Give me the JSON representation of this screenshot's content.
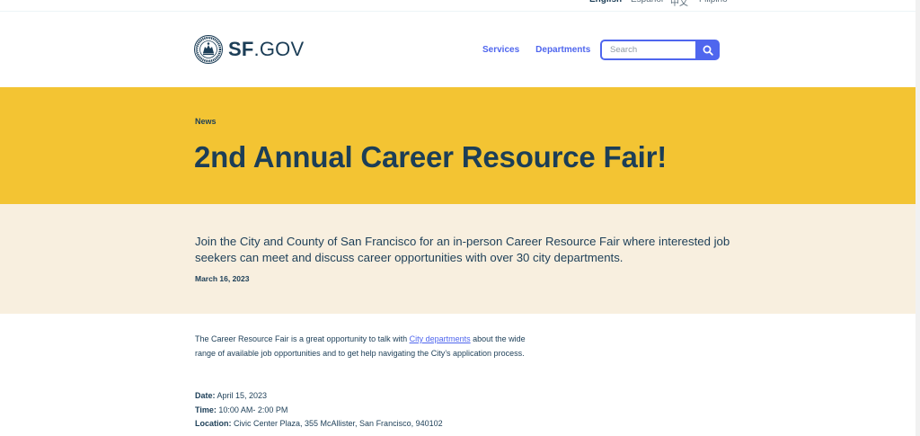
{
  "language_bar": {
    "languages": [
      "English",
      "Español",
      "中文",
      "Filipino"
    ]
  },
  "header": {
    "logo_bold": "SF",
    "logo_rest": ".GOV",
    "nav": [
      "Services",
      "Departments"
    ],
    "search_placeholder": "Search"
  },
  "hero": {
    "eyebrow": "News",
    "title": "2nd Annual Career Resource Fair!"
  },
  "summary": {
    "text": "Join the City and County of San Francisco for an in-person Career Resource Fair where interested job seekers can meet and discuss career opportunities with over 30 city departments.",
    "date": "March 16, 2023"
  },
  "body": {
    "intro_before": "The Career Resource Fair is a great opportunity to talk with ",
    "intro_link": "City departments",
    "intro_after": " about the wide range of available job opportunities and to get help navigating the City’s application process.",
    "details": [
      {
        "label": "Date:",
        "value": " April 15, 2023"
      },
      {
        "label": "Time:",
        "value": " 10:00 AM- 2:00 PM"
      },
      {
        "label": "Location:",
        "value": " Civic Center Plaza, 355 McAllister, San Francisco, 940102"
      }
    ]
  },
  "colors": {
    "brand_blue": "#4f66ee",
    "hero_yellow": "#f3c433",
    "summary_cream": "#f8efdf",
    "text_navy": "#1c3e57"
  }
}
